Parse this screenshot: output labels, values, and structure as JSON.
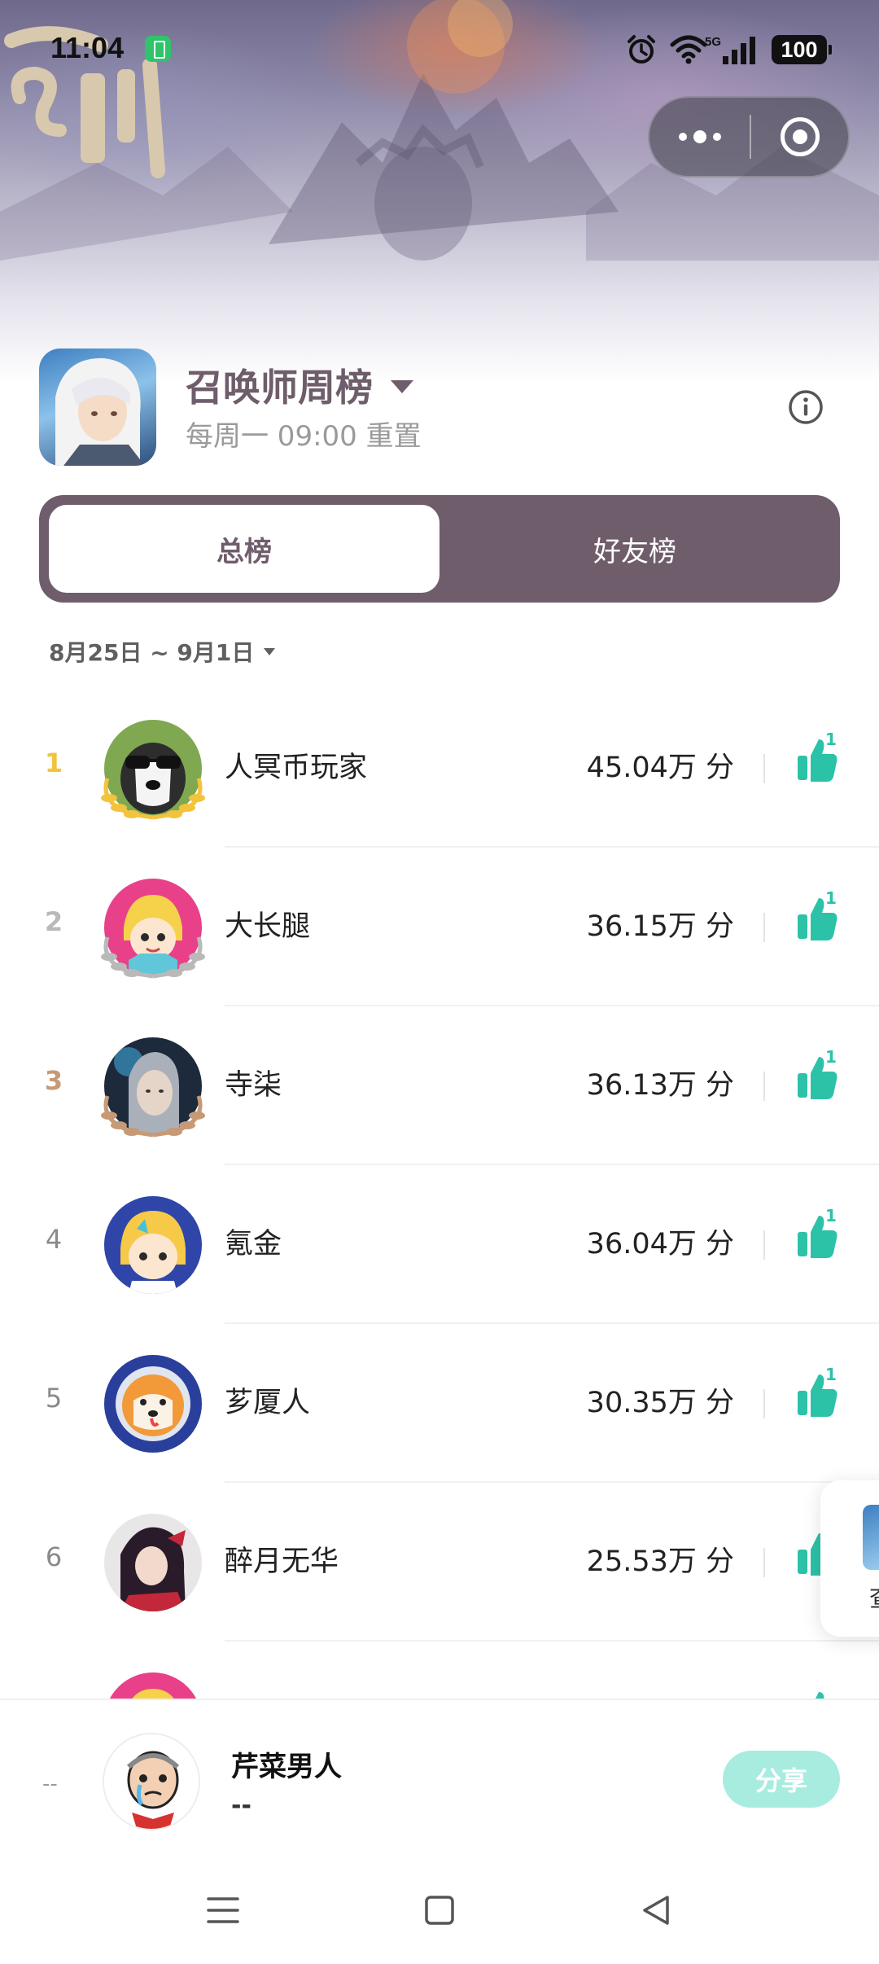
{
  "status_bar": {
    "time": "11:04",
    "network": "5G",
    "battery": "100",
    "icons": [
      "battery-saver-icon",
      "alarm-icon",
      "wifi-icon",
      "signal-icon",
      "battery-icon"
    ]
  },
  "capsule": {
    "more_icon": "more-dots-icon",
    "close_icon": "target-close-icon"
  },
  "board": {
    "title": "召唤师周榜",
    "subtitle": "每周一 09:00 重置",
    "info_icon": "info-icon"
  },
  "tabs": [
    {
      "label": "总榜",
      "active": true
    },
    {
      "label": "好友榜",
      "active": false
    }
  ],
  "date_range": "8月25日 ~ 9月1日",
  "rankings": [
    {
      "rank": "1",
      "name": "人冥币玩家",
      "score": "45.04万 分",
      "likes": "1"
    },
    {
      "rank": "2",
      "name": "大长腿",
      "score": "36.15万 分",
      "likes": "1"
    },
    {
      "rank": "3",
      "name": "寺柒",
      "score": "36.13万 分",
      "likes": "1"
    },
    {
      "rank": "4",
      "name": "氪金",
      "score": "36.04万 分",
      "likes": "1"
    },
    {
      "rank": "5",
      "name": "芗厦人",
      "score": "30.35万 分",
      "likes": "1"
    },
    {
      "rank": "6",
      "name": "醉月无华",
      "score": "25.53万 分",
      "likes": ""
    }
  ],
  "side_card": {
    "label": "查"
  },
  "me": {
    "rank": "--",
    "name": "芹菜男人",
    "score": "--",
    "share_label": "分享"
  },
  "colors": {
    "accent": "#2cc2a8",
    "tab_bg": "#6f5d6c",
    "gold": "#f2c33d",
    "silver": "#b9b9b9",
    "bronze": "#c69a76"
  }
}
